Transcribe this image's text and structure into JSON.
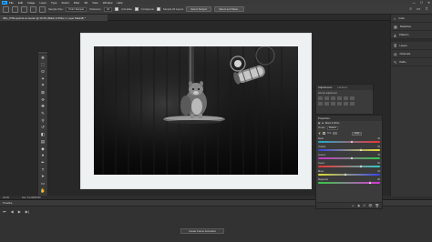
{
  "menubar": {
    "logo": "Ps",
    "items": [
      "File",
      "Edit",
      "Image",
      "Layer",
      "Type",
      "Select",
      "Filter",
      "3D",
      "View",
      "Window",
      "Help"
    ],
    "controls": [
      "—",
      "☐",
      "✕"
    ]
  },
  "optionsbar": {
    "sample_size_label": "Sample Size:",
    "sample_size_value": "Point Sample",
    "tolerance_label": "Tolerance:",
    "tolerance_value": "32",
    "anti_alias": "Anti-alias",
    "contiguous": "Contiguous",
    "sample_all_layers": "Sample All Layers",
    "select_subject": "Select Subject",
    "select_and_mask": "Select and Mask..."
  },
  "document": {
    "tab_title": "IMG_0709-squirrel-on-feeder @ 26.6% (Black & White 1, Layer Mask/8) *"
  },
  "status": {
    "zoom": "26.6%",
    "doc_info": "Doc: 34.2M/68.5M"
  },
  "timeline": {
    "tab": "Timeline",
    "create_button": "Create Frame Animation"
  },
  "panels": {
    "collapsed": [
      {
        "icon": "◐",
        "label": "Color"
      },
      {
        "icon": "▦",
        "label": "Swatches"
      },
      {
        "icon": "◭",
        "label": "Patterns"
      },
      {
        "icon": "≣",
        "label": "Layers"
      },
      {
        "icon": "◍",
        "label": "Channels"
      },
      {
        "icon": "✎",
        "label": "Paths"
      }
    ]
  },
  "adjustments": {
    "tab_active": "Adjustments",
    "tab_inactive": "Libraries",
    "subtitle": "Add an adjustment"
  },
  "properties": {
    "title": "Properties",
    "type_label": "Black & White",
    "preset_label": "Preset:",
    "preset_value": "Default",
    "tint_label": "Tint",
    "auto_button": "Auto",
    "sliders": [
      {
        "name": "Reds",
        "value": "40",
        "pct": 0.55,
        "colors": [
          "#22aacc",
          "#ee3333"
        ]
      },
      {
        "name": "Yellows",
        "value": "60",
        "pct": 0.7,
        "colors": [
          "#3344dd",
          "#eedd33"
        ]
      },
      {
        "name": "Greens",
        "value": "40",
        "pct": 0.55,
        "colors": [
          "#cc33cc",
          "#33cc44"
        ]
      },
      {
        "name": "Cyans",
        "value": "60",
        "pct": 0.7,
        "colors": [
          "#ee3333",
          "#33cccc"
        ]
      },
      {
        "name": "Blues",
        "value": "20",
        "pct": 0.45,
        "colors": [
          "#dddd33",
          "#3344ee"
        ]
      },
      {
        "name": "Magentas",
        "value": "80",
        "pct": 0.85,
        "colors": [
          "#33cc44",
          "#dd33dd"
        ]
      }
    ]
  },
  "colors": {
    "foreground": "#000000",
    "background": "#ffffff",
    "accent": "#2fa3f5"
  }
}
